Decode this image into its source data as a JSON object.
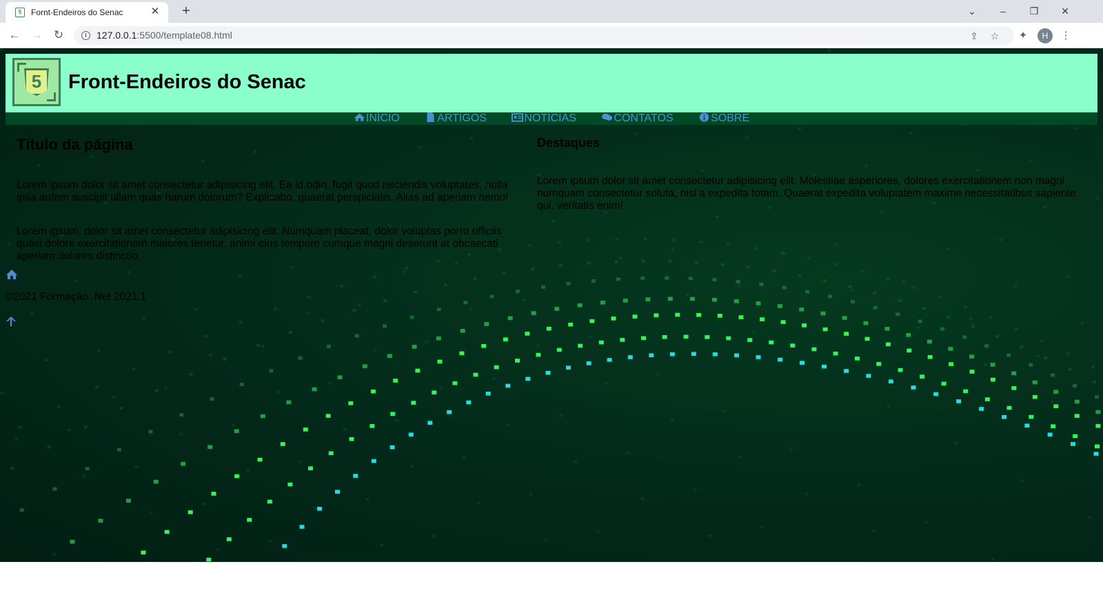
{
  "browser": {
    "tab_title": "Fornt-Endeiros do Senac",
    "favicon_glyph": "5",
    "new_tab": "+",
    "url_host": "127.0.0.1",
    "url_path": ":5500/template08.html",
    "profile_initial": "H"
  },
  "site": {
    "title": "Front-Endeiros do Senac",
    "logo_glyph": "5",
    "nav": [
      {
        "label": "INÍCIO",
        "icon": "home-icon"
      },
      {
        "label": "ARTIGOS",
        "icon": "file-icon"
      },
      {
        "label": "NOTÍCIAS",
        "icon": "newspaper-icon"
      },
      {
        "label": "CONTATOS",
        "icon": "comments-icon"
      },
      {
        "label": "SOBRE",
        "icon": "info-circle-icon"
      }
    ],
    "nav_color": "#4d8fd6",
    "header_bg": "#8affcc",
    "main": {
      "heading": "Título da página",
      "paragraphs": [
        "Lorem ipsum dolor sit amet consectetur adipisicing elit. Ea id odio, fugit quod reiciendis voluptates, nulla ipsa autem suscipit ullam quas harum dolorum? Explicabo, quaerat perspiciatis. Alias ad aperiam nemo!",
        "Lorem ipsum, dolor sit amet consectetur adipisicing elit. Numquam placeat, dolor voluptas porro officiis quasi dolore exercitationem maiores tenetur, animi eius tempore cumque magni deserunt at obcaecati aperiam dolores distinctio."
      ]
    },
    "aside": {
      "heading": "Destaques",
      "paragraph": "Lorem ipsum dolor sit amet consectetur adipisicing elit. Molestiae asperiores, dolores exercitationem non magni numquam consectetur soluta, nisi a expedita totam. Quaerat expedita voluptatem maxime necessitatibus sapiente qui, veritatis enim!"
    },
    "footer": {
      "copyright": "©2021 Formação .Net 2021.1"
    }
  }
}
